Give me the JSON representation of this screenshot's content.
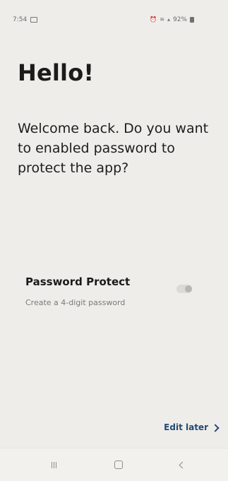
{
  "status_bar": {
    "time": "7:54",
    "battery_percent": "92%",
    "icons": {
      "left": "gallery-icon",
      "right": [
        "alarm-icon",
        "wifi-icon",
        "signal-icon",
        "battery-icon"
      ]
    }
  },
  "main": {
    "title": "Hello!",
    "message": "Welcome back. Do you want to enabled password to protect the app?"
  },
  "password_setting": {
    "title": "Password Protect",
    "subtitle": "Create a 4-digit password",
    "enabled": false
  },
  "actions": {
    "edit_later": "Edit later"
  },
  "navigation": {
    "buttons": [
      "recent-apps",
      "home",
      "back"
    ]
  }
}
